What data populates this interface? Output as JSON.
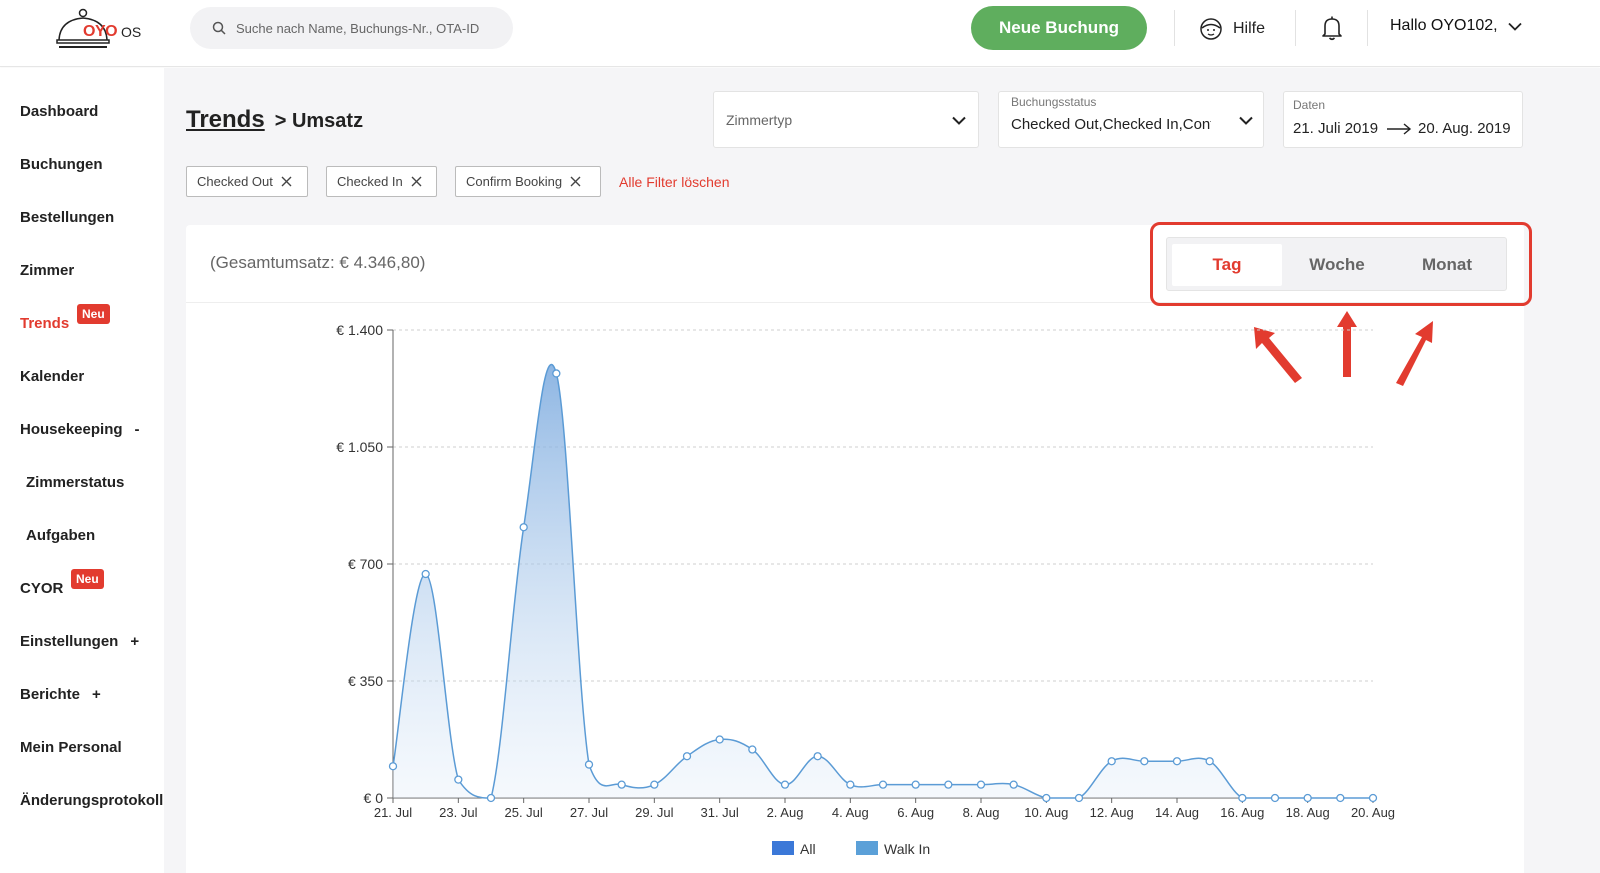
{
  "header": {
    "logo_brand": "OYO",
    "logo_suffix": "OS",
    "search_placeholder": "Suche nach Name, Buchungs-Nr., OTA-ID",
    "new_booking_label": "Neue Buchung",
    "help_label": "Hilfe",
    "greeting": "Hallo OYO102,"
  },
  "sidebar": {
    "items": [
      {
        "label": "Dashboard"
      },
      {
        "label": "Buchungen"
      },
      {
        "label": "Bestellungen"
      },
      {
        "label": "Zimmer"
      },
      {
        "label": "Trends",
        "badge": "Neu"
      },
      {
        "label": "Kalender"
      },
      {
        "label": "Housekeeping",
        "sign": "-"
      },
      {
        "label": "Zimmerstatus"
      },
      {
        "label": "Aufgaben"
      },
      {
        "label": "CYOR",
        "badge": "Neu"
      },
      {
        "label": "Einstellungen",
        "sign": "+"
      },
      {
        "label": "Berichte",
        "sign": "+"
      },
      {
        "label": "Mein Personal"
      },
      {
        "label": "Änderungsprotokoll"
      }
    ]
  },
  "breadcrumb": {
    "parent": "Trends",
    "current": "> Umsatz"
  },
  "filters": {
    "room_type": {
      "placeholder": "Zimmertyp"
    },
    "booking_status": {
      "label": "Buchungsstatus",
      "value": "Checked Out,Checked In,Confirm Booking"
    },
    "dates": {
      "label": "Daten",
      "from": "21. Juli 2019",
      "to": "20. Aug. 2019"
    }
  },
  "chips": [
    "Checked Out",
    "Checked In",
    "Confirm Booking"
  ],
  "clear_filters_label": "Alle Filter löschen",
  "total_revenue": "(Gesamtumsatz: € 4.346,80)",
  "granularity": {
    "options": [
      "Tag",
      "Woche",
      "Monat"
    ],
    "selected": "Tag"
  },
  "colors": {
    "accent": "#e23b2f",
    "primary_button": "#5fae5e",
    "line": "#5b9bd5"
  },
  "chart_data": {
    "type": "area",
    "title": "",
    "xlabel": "",
    "ylabel": "",
    "ylim": [
      0,
      1400
    ],
    "y_ticks": [
      "€ 0",
      "€ 350",
      "€ 700",
      "€ 1.050",
      "€ 1.400"
    ],
    "y_tick_values": [
      0,
      350,
      700,
      1050,
      1400
    ],
    "grid": true,
    "x_tick_labels": [
      "21. Jul",
      "23. Jul",
      "25. Jul",
      "27. Jul",
      "29. Jul",
      "31. Jul",
      "2. Aug",
      "4. Aug",
      "6. Aug",
      "8. Aug",
      "10. Aug",
      "12. Aug",
      "14. Aug",
      "16. Aug",
      "18. Aug",
      "20. Aug"
    ],
    "x": [
      "21. Jul",
      "22. Jul",
      "23. Jul",
      "24. Jul",
      "25. Jul",
      "26. Jul",
      "27. Jul",
      "28. Jul",
      "29. Jul",
      "30. Jul",
      "31. Jul",
      "1. Aug",
      "2. Aug",
      "3. Aug",
      "4. Aug",
      "5. Aug",
      "6. Aug",
      "7. Aug",
      "8. Aug",
      "9. Aug",
      "10. Aug",
      "11. Aug",
      "12. Aug",
      "13. Aug",
      "14. Aug",
      "15. Aug",
      "16. Aug",
      "17. Aug",
      "18. Aug",
      "19. Aug",
      "20. Aug"
    ],
    "series": [
      {
        "values": [
          95,
          670,
          55,
          0,
          810,
          1270,
          100,
          40,
          40,
          125,
          175,
          145,
          40,
          125,
          40,
          40,
          40,
          40,
          40,
          40,
          0,
          0,
          110,
          110,
          110,
          110,
          0,
          0,
          0,
          0,
          0
        ]
      }
    ],
    "legend_labels": [
      "All",
      "Walk In"
    ],
    "legend_position": "bottom"
  }
}
